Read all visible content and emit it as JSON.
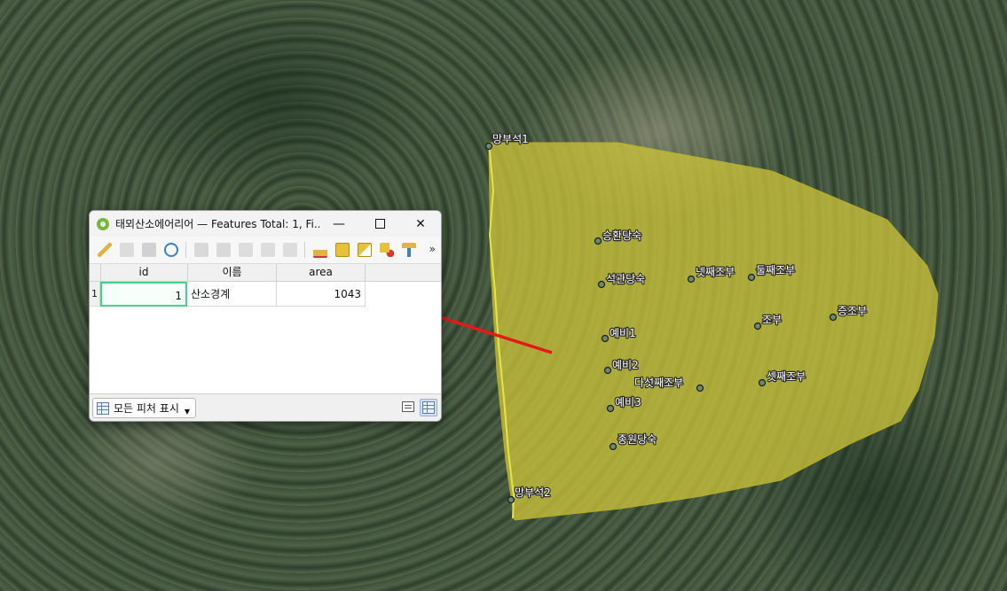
{
  "map": {
    "labels": [
      {
        "name": "망부석1-label",
        "text": "망부석1"
      },
      {
        "name": "승환당숙-label",
        "text": "승환당숙"
      },
      {
        "name": "석관당숙-label",
        "text": "석관당숙"
      },
      {
        "name": "넷째조부-label",
        "text": "넷째조부"
      },
      {
        "name": "둘째조부-label",
        "text": "둘째조부"
      },
      {
        "name": "증조부-label",
        "text": "증조부"
      },
      {
        "name": "조부-label",
        "text": "조부"
      },
      {
        "name": "예비1-label",
        "text": "예비1"
      },
      {
        "name": "예비2-label",
        "text": "예비2"
      },
      {
        "name": "다섯째조부-label",
        "text": "다섯째조부"
      },
      {
        "name": "셋째조부-label",
        "text": "셋째조부"
      },
      {
        "name": "예비3-label",
        "text": "예비3"
      },
      {
        "name": "종원당숙-label",
        "text": "종원당숙"
      },
      {
        "name": "망부석2-label",
        "text": "망부석2"
      }
    ],
    "polygon_fill": "#c9c23a",
    "arrow_color": "#e51919"
  },
  "window": {
    "title": "태뫼산소에어리어 — Features Total: 1, Fi...",
    "minimize_icon": "minimize-icon",
    "maximize_icon": "maximize-icon",
    "close_icon": "close-icon"
  },
  "toolbar": {
    "more": "»",
    "icons": [
      "edit-pencil-icon",
      "multi-edit-icon",
      "save-icon",
      "reload-icon",
      "add-feature-icon",
      "delete-icon",
      "cut-icon",
      "copy-icon",
      "paste-icon",
      "expression-select-icon",
      "select-all-icon",
      "invert-selection-icon",
      "deselect-icon",
      "filter-icon"
    ]
  },
  "table": {
    "columns": [
      "id",
      "이름",
      "area"
    ],
    "rows": [
      {
        "row_header": "1",
        "id": "1",
        "name": "산소경계",
        "area": "1043"
      }
    ]
  },
  "bottom": {
    "show_all_label": "모든 피처 표시",
    "dropdown_icon": "chevron-down-icon"
  }
}
